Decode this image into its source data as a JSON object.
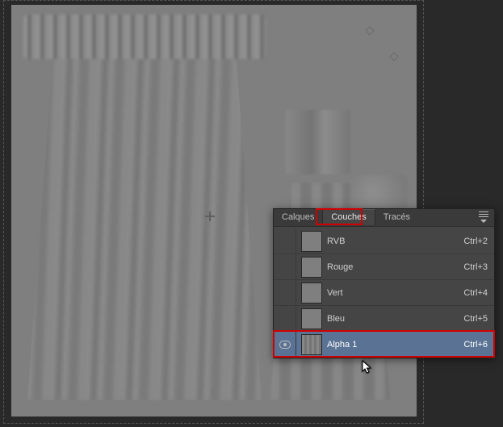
{
  "tabs": {
    "t0": "Calques",
    "t1": "Couches",
    "t2": "Tracés",
    "active_index": 1
  },
  "channels": [
    {
      "name": "RVB",
      "shortcut": "Ctrl+2",
      "visible": false,
      "selected": false,
      "thumb": "rgb"
    },
    {
      "name": "Rouge",
      "shortcut": "Ctrl+3",
      "visible": false,
      "selected": false,
      "thumb": "r"
    },
    {
      "name": "Vert",
      "shortcut": "Ctrl+4",
      "visible": false,
      "selected": false,
      "thumb": "g"
    },
    {
      "name": "Bleu",
      "shortcut": "Ctrl+5",
      "visible": false,
      "selected": false,
      "thumb": "b"
    },
    {
      "name": "Alpha 1",
      "shortcut": "Ctrl+6",
      "visible": true,
      "selected": true,
      "thumb": "alpha"
    }
  ],
  "highlight": {
    "tab_color": "#d10000",
    "row_color": "#d10000"
  }
}
